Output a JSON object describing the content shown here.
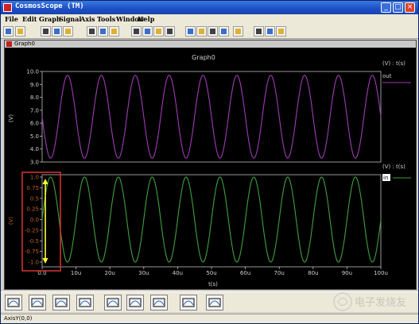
{
  "window": {
    "title": "CosmosScope (TM)"
  },
  "menu": [
    "File",
    "Edit",
    "Graph",
    "Signal",
    "Axis",
    "Tools",
    "Window",
    "Help"
  ],
  "toolbar_icons": [
    "new-icon",
    "open-icon",
    "save-icon",
    "print-icon",
    "cut-icon",
    "copy-icon",
    "paste-icon",
    "zoom-in-icon",
    "zoom-out-icon",
    "zoom-fit-icon",
    "zoom-box-icon",
    "stack-icon",
    "color-icon",
    "grid-icon",
    "lines-icon",
    "marker-icon",
    "waveform-icon",
    "calculator-icon",
    "measure-icon",
    "axis-icon"
  ],
  "graph_window": {
    "tab_label": "Graph0",
    "title": "Graph0"
  },
  "colors": {
    "upper_trace": "#a03cb4",
    "lower_trace": "#3fa03f",
    "highlight": "#d03030",
    "arrow": "#ffff33",
    "axis_text": "#d0d0d0",
    "lower_axis_text": "#c06020"
  },
  "chart_data": [
    {
      "type": "line",
      "title": "Graph0",
      "ylabel": "(V)",
      "xlabel": "",
      "legend_label": "(V) : t(s)",
      "series": [
        {
          "name": "out",
          "shape": "sine",
          "offset": 6.5,
          "amplitude": 3.2,
          "period_us": 10,
          "phase_deg": 180
        }
      ],
      "yticks": [
        "10.0",
        "9.0",
        "8.0",
        "7.0",
        "6.0",
        "5.0",
        "4.0",
        "3.0"
      ],
      "ylim": [
        3.0,
        10.0
      ],
      "xlim": [
        0,
        100
      ]
    },
    {
      "type": "line",
      "ylabel": "(V)",
      "xlabel": "t(s)",
      "legend_label": "(V) : t(s)",
      "series": [
        {
          "name": "in",
          "shape": "sine",
          "offset": 0,
          "amplitude": 1.0,
          "period_us": 10,
          "phase_deg": 0
        }
      ],
      "yticks": [
        "1.0",
        "0.75",
        "0.5",
        "0.25",
        "0.0",
        "-0.25",
        "-0.5",
        "-0.75",
        "-1.0"
      ],
      "ylim": [
        -1.0,
        1.0
      ],
      "xticks": [
        "0.0",
        "10u",
        "20u",
        "30u",
        "40u",
        "50u",
        "60u",
        "70u",
        "80u",
        "90u",
        "100u"
      ],
      "xlim": [
        0,
        100
      ]
    }
  ],
  "status": {
    "text": "AxisY(0,0)"
  },
  "palette_icons": [
    "keyboard-icon",
    "pen-icon",
    "scope-icon",
    "curve-icon",
    "calculator-icon",
    "radiation-icon",
    "block-diagram-icon",
    "matlab-icon",
    "pie-icon"
  ],
  "watermark": {
    "text": "电子发烧友"
  }
}
